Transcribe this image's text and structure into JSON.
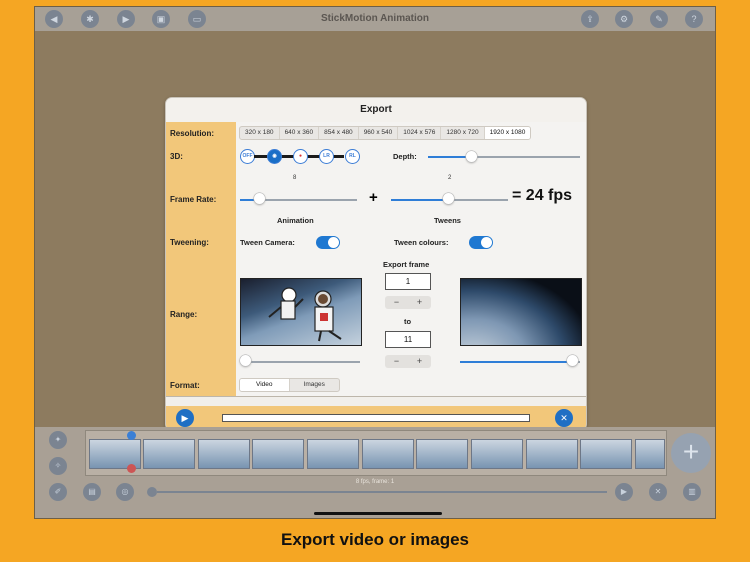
{
  "app": {
    "title": "StickMotion Animation"
  },
  "toolbar": {
    "left_icons": [
      "back-icon",
      "settings-gear-icon",
      "camera-icon",
      "clipboard-icon",
      "tv-icon"
    ],
    "right_icons": [
      "export-share-icon",
      "gear-icon",
      "wrench-icon",
      "help-icon"
    ]
  },
  "dialog": {
    "title": "Export",
    "resolution": {
      "label": "Resolution:",
      "options": [
        "320 x 180",
        "640 x 360",
        "854 x 480",
        "960 x 540",
        "1024 x 576",
        "1280 x 720",
        "1920 x 1080"
      ],
      "selected": "1920 x 1080"
    },
    "three_d": {
      "label": "3D:",
      "options": [
        "OFF",
        "anaglyph",
        "red-cyan",
        "LR",
        "RL"
      ],
      "option_labels": {
        "off": "OFF",
        "lr": "LR",
        "rl": "RL"
      },
      "selected": "anaglyph",
      "depth_label": "Depth:",
      "depth_value": 0.28
    },
    "frame_rate": {
      "label": "Frame Rate:",
      "animation_value": "8",
      "animation_label": "Animation",
      "tweens_value": "2",
      "tweens_label": "Tweens",
      "plus": "+",
      "result": "= 24 fps"
    },
    "tweening": {
      "label": "Tweening:",
      "camera_label": "Tween Camera:",
      "camera_on": true,
      "colours_label": "Tween colours:",
      "colours_on": true
    },
    "range": {
      "label": "Range:",
      "export_frame_label": "Export frame",
      "from_value": "1",
      "to_label": "to",
      "to_value": "11",
      "minus": "−",
      "plus": "+"
    },
    "format": {
      "label": "Format:",
      "options": [
        "Video",
        "Images"
      ],
      "selected": "Video"
    }
  },
  "timeline": {
    "status": "8 fps, frame: 1",
    "frame_count": 11
  },
  "caption": "Export video or images",
  "colors": {
    "background": "#F5A623",
    "accent": "#1F78D1",
    "label_bg": "#F2C77A"
  }
}
